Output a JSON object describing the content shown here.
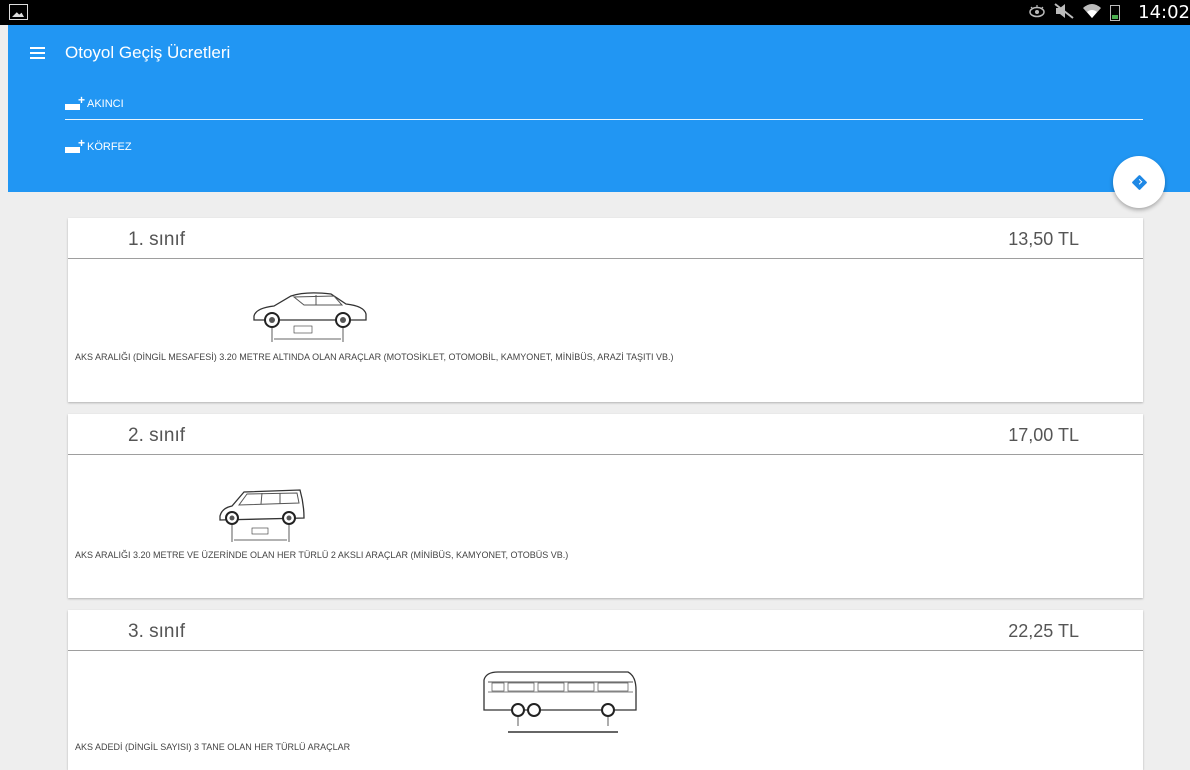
{
  "status_bar": {
    "time": "14:02",
    "icons": [
      "gallery-icon",
      "eye-icon",
      "mute-icon",
      "wifi-icon",
      "battery-icon"
    ]
  },
  "header": {
    "title": "Otoyol Geçiş Ücretleri",
    "routes": [
      "AKINCI",
      "KÖRFEZ"
    ],
    "color": "#2196f3"
  },
  "classes": [
    {
      "name": "1. sınıf",
      "price": "13,50 TL",
      "description": "AKS ARALIĞI (DİNGİL MESAFESİ) 3.20 METRE ALTINDA OLAN ARAÇLAR (MOTOSİKLET, OTOMOBİL, KAMYONET, MİNİBÜS, ARAZİ TAŞITI VB.)",
      "vehicle": "sedan-car-icon"
    },
    {
      "name": "2. sınıf",
      "price": "17,00 TL",
      "description": "AKS ARALIĞI 3.20 METRE VE ÜZERİNDE OLAN HER TÜRLÜ 2 AKSLI ARAÇLAR (MİNİBÜS, KAMYONET, OTOBÜS VB.)",
      "vehicle": "minivan-icon"
    },
    {
      "name": "3. sınıf",
      "price": "22,25 TL",
      "description": "AKS ADEDİ (DİNGİL SAYISI) 3 TANE OLAN HER TÜRLÜ ARAÇLAR",
      "vehicle": "bus-icon"
    }
  ]
}
